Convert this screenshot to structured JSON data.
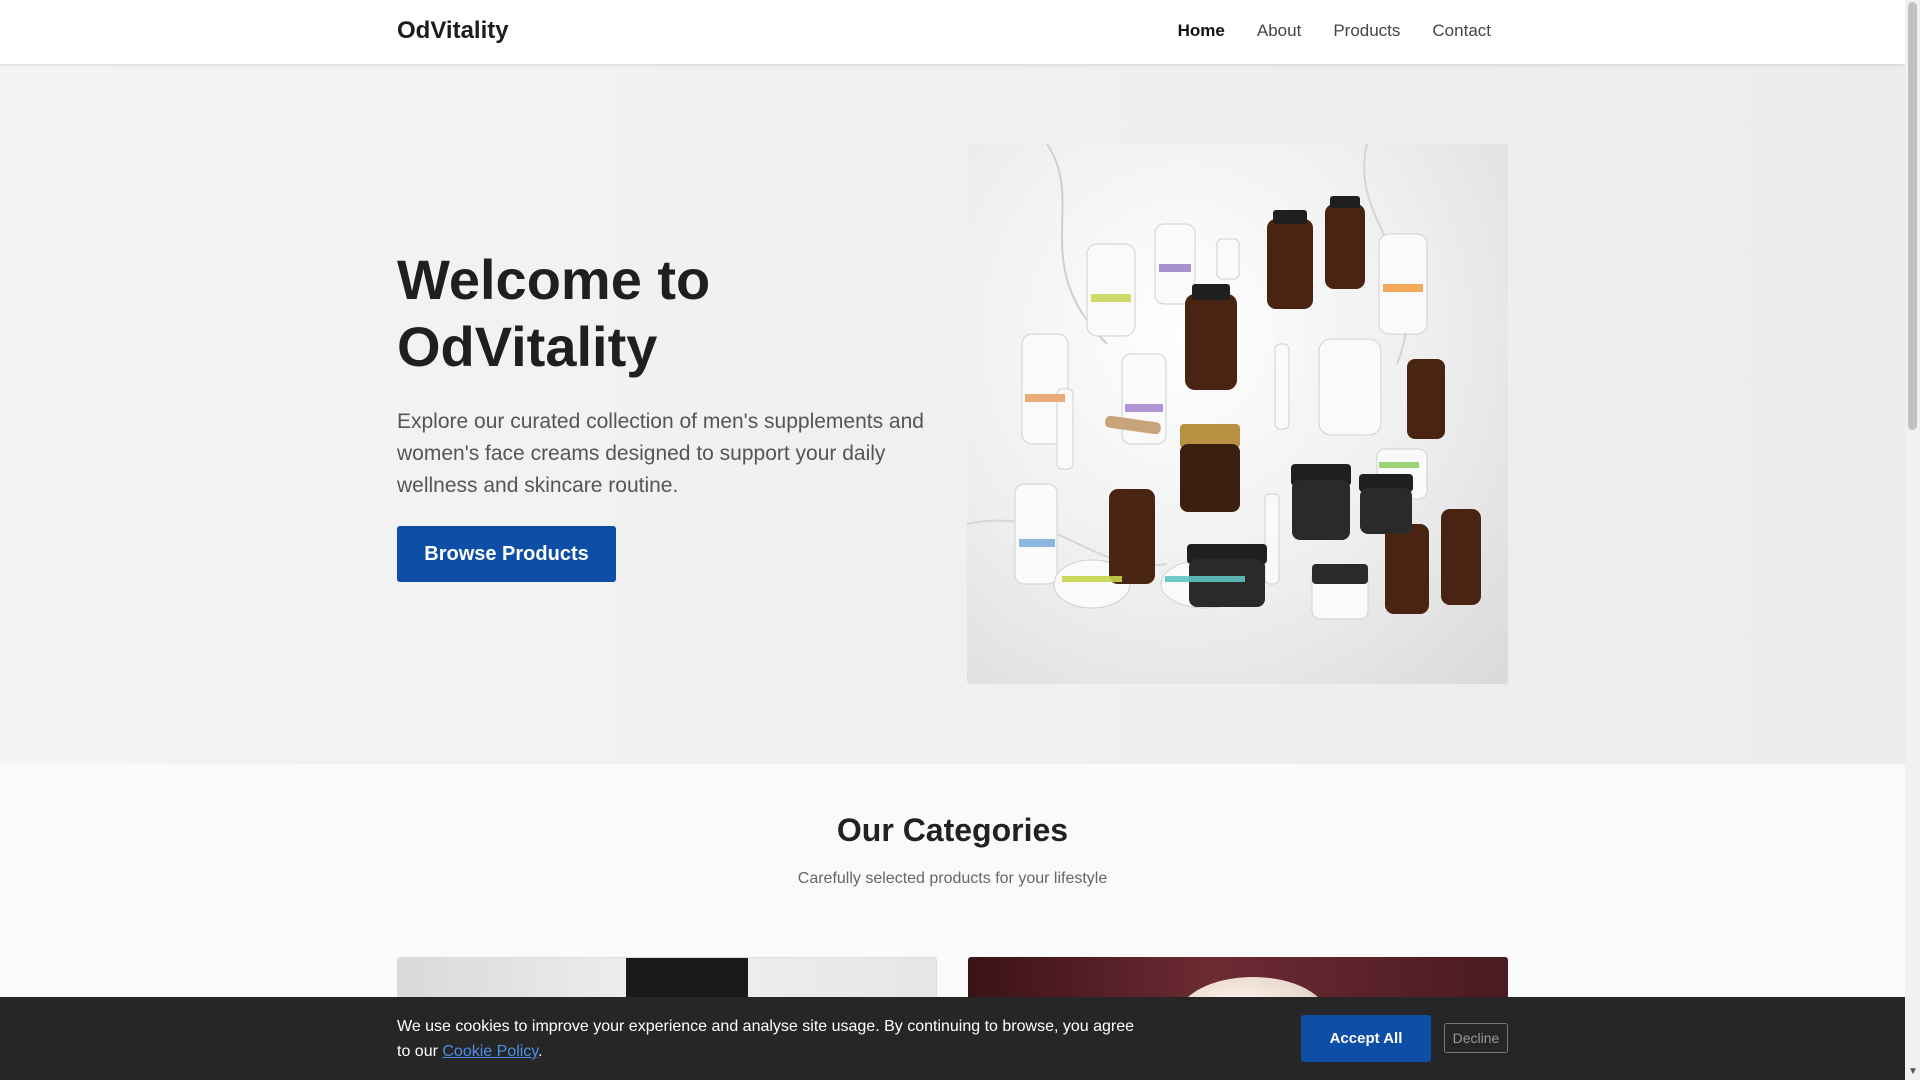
{
  "header": {
    "brand": "OdVitality",
    "nav": [
      {
        "label": "Home",
        "active": true
      },
      {
        "label": "About",
        "active": false
      },
      {
        "label": "Products",
        "active": false
      },
      {
        "label": "Contact",
        "active": false
      }
    ]
  },
  "hero": {
    "title": "Welcome to OdVitality",
    "description": "Explore our curated collection of men's supplements and women's face creams designed to support your daily wellness and skincare routine.",
    "button_label": "Browse Products"
  },
  "categories": {
    "title": "Our Categories",
    "subtitle": "Carefully selected products for your lifestyle"
  },
  "cookie": {
    "text": "We use cookies to improve your experience and analyse site usage. By continuing to browse, you agree to our",
    "link_label": "Cookie Policy",
    "after_link": ".",
    "accept_label": "Accept All",
    "decline_label": "Decline"
  },
  "colors": {
    "primary": "#0d4ea6",
    "cookie_bg": "#262626",
    "link": "#4a8fe8"
  }
}
